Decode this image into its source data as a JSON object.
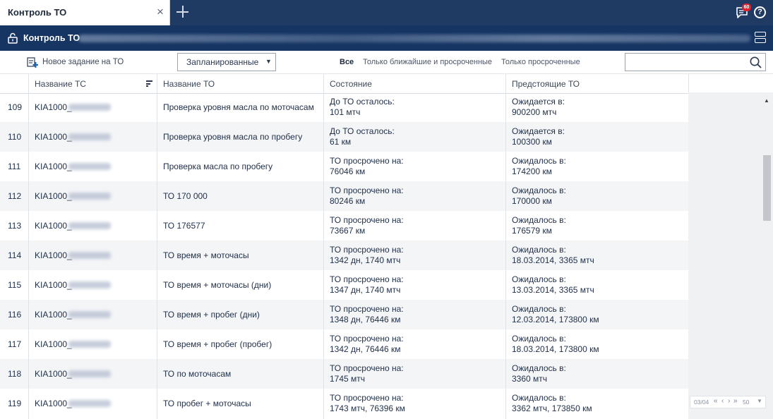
{
  "tabs": {
    "active_title": "Контроль ТО",
    "close_glyph": "×"
  },
  "notifications": {
    "badge_count": "60"
  },
  "help": {
    "glyph": "?"
  },
  "objectbar": {
    "title": "Контроль ТО"
  },
  "toolbar": {
    "new_task_label": "Новое задание на ТО",
    "select_value": "Запланированные",
    "filters": [
      "Все",
      "Только ближайшие и просроченные",
      "Только просроченные"
    ],
    "active_filter": "Все",
    "search_placeholder": ""
  },
  "columns": [
    "Название ТС",
    "Название ТО",
    "Состояние",
    "Предстоящие ТО"
  ],
  "rows": [
    {
      "num": "109",
      "vehicle": "KIA1000_",
      "task": "Проверка уровня масла по моточасам",
      "state1": "До ТО осталось:",
      "state2": "101 мтч",
      "due1": "Ожидается в:",
      "due2": "900200 мтч"
    },
    {
      "num": "110",
      "vehicle": "KIA1000_",
      "task": "Проверка уровня масла по пробегу",
      "state1": "До ТО осталось:",
      "state2": "61 км",
      "due1": "Ожидается в:",
      "due2": "100300 км"
    },
    {
      "num": "111",
      "vehicle": "KIA1000_",
      "task": "Проверка масла по пробегу",
      "state1": "ТО просрочено на:",
      "state2": "76046 км",
      "due1": "Ожидалось в:",
      "due2": "174200 км"
    },
    {
      "num": "112",
      "vehicle": "KIA1000_",
      "task": "ТО 170 000",
      "state1": "ТО просрочено на:",
      "state2": "80246 км",
      "due1": "Ожидалось в:",
      "due2": "170000 км"
    },
    {
      "num": "113",
      "vehicle": "KIA1000_",
      "task": "ТО 176577",
      "state1": "ТО просрочено на:",
      "state2": "73667 км",
      "due1": "Ожидалось в:",
      "due2": "176579 км"
    },
    {
      "num": "114",
      "vehicle": "KIA1000_",
      "task": "ТО время + моточасы",
      "state1": "ТО просрочено на:",
      "state2": "1342 дн, 1740 мтч",
      "due1": "Ожидалось в:",
      "due2": "18.03.2014, 3365 мтч"
    },
    {
      "num": "115",
      "vehicle": "KIA1000_",
      "task": "ТО время + моточасы (дни)",
      "state1": "ТО просрочено на:",
      "state2": "1347 дн, 1740 мтч",
      "due1": "Ожидалось в:",
      "due2": "13.03.2014, 3365 мтч"
    },
    {
      "num": "116",
      "vehicle": "KIA1000_",
      "task": "ТО время + пробег (дни)",
      "state1": "ТО просрочено на:",
      "state2": "1348 дн, 76446 км",
      "due1": "Ожидалось в:",
      "due2": "12.03.2014, 173800 км"
    },
    {
      "num": "117",
      "vehicle": "KIA1000_",
      "task": "ТО время + пробег (пробег)",
      "state1": "ТО просрочено на:",
      "state2": "1342 дн, 76446 км",
      "due1": "Ожидалось в:",
      "due2": "18.03.2014, 173800 км"
    },
    {
      "num": "118",
      "vehicle": "KIA1000_",
      "task": "ТО по моточасам",
      "state1": "ТО просрочено на:",
      "state2": "1745 мтч",
      "due1": "Ожидалось в:",
      "due2": "3360 мтч"
    },
    {
      "num": "119",
      "vehicle": "KIA1000_",
      "task": "ТО пробег + моточасы",
      "state1": "ТО просрочено на:",
      "state2": "1743 мтч, 76396 км",
      "due1": "Ожидалось в:",
      "due2": "3362 мтч, 173850 км"
    }
  ],
  "pager": {
    "pages": "03/04",
    "first": "«",
    "prev": "‹",
    "next": "›",
    "last": "»",
    "page_size": "50"
  },
  "colors": {
    "header_bg": "#1f3a63",
    "objbar_bg": "#163563",
    "row_alt": "#f4f5f7",
    "badge": "#e2232e"
  }
}
